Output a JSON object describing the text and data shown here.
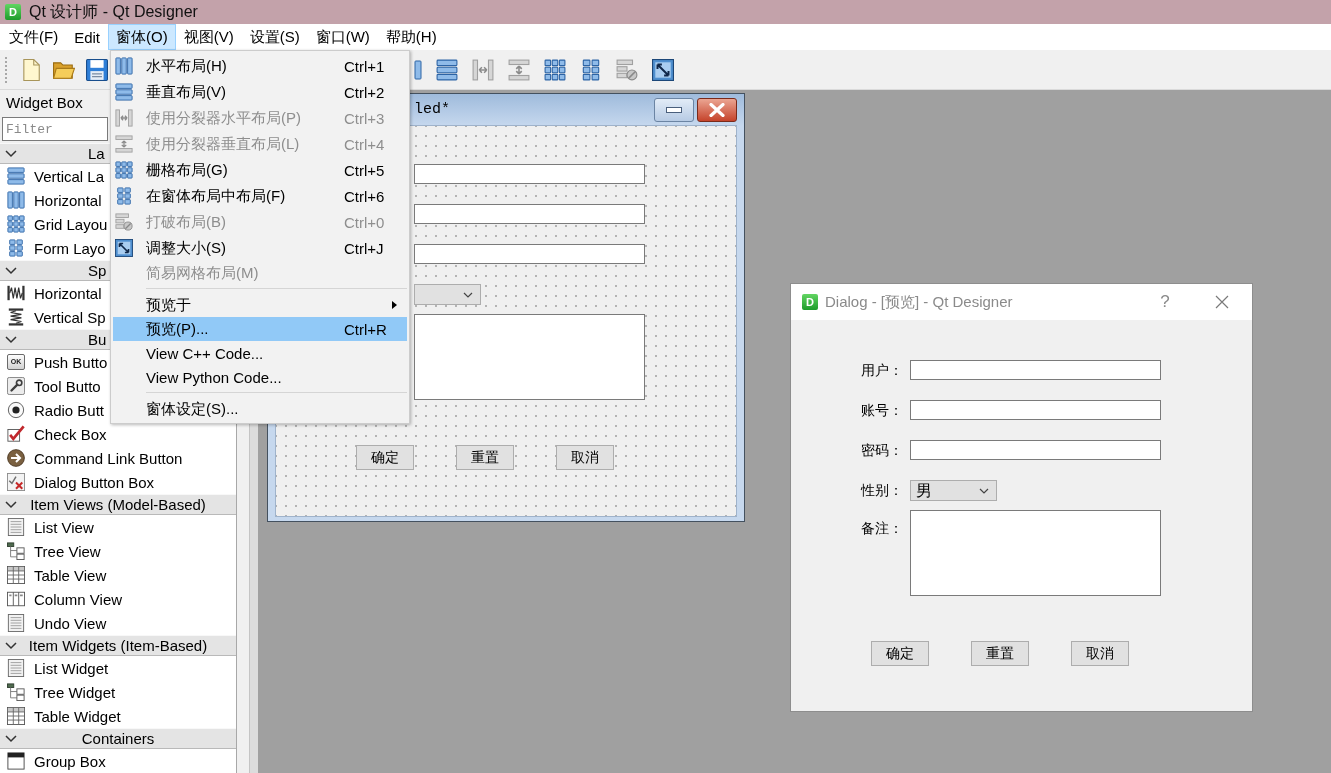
{
  "window": {
    "logo": "D",
    "title": "Qt 设计师 - Qt Designer"
  },
  "menu_bar": [
    {
      "label": "文件(F)",
      "selected": false
    },
    {
      "label": "Edit",
      "selected": false
    },
    {
      "label": "窗体(O)",
      "selected": true
    },
    {
      "label": "视图(V)",
      "selected": false
    },
    {
      "label": "设置(S)",
      "selected": false
    },
    {
      "label": "窗口(W)",
      "selected": false
    },
    {
      "label": "帮助(H)",
      "selected": false
    }
  ],
  "form_menu": {
    "sections": [
      {
        "items": [
          {
            "kind": "action",
            "label": "水平布局(H)",
            "shortcut": "Ctrl+1",
            "disabled": false,
            "selected": false
          },
          {
            "kind": "action",
            "label": "垂直布局(V)",
            "shortcut": "Ctrl+2",
            "disabled": false,
            "selected": false
          },
          {
            "kind": "action",
            "label": "使用分裂器水平布局(P)",
            "shortcut": "Ctrl+3",
            "disabled": true,
            "selected": false
          },
          {
            "kind": "action",
            "label": "使用分裂器垂直布局(L)",
            "shortcut": "Ctrl+4",
            "disabled": true,
            "selected": false
          },
          {
            "kind": "action",
            "label": "栅格布局(G)",
            "shortcut": "Ctrl+5",
            "disabled": false,
            "selected": false
          },
          {
            "kind": "action",
            "label": "在窗体布局中布局(F)",
            "shortcut": "Ctrl+6",
            "disabled": false,
            "selected": false
          },
          {
            "kind": "action",
            "label": "打破布局(B)",
            "shortcut": "Ctrl+0",
            "disabled": true,
            "selected": false
          },
          {
            "kind": "action",
            "label": "调整大小(S)",
            "shortcut": "Ctrl+J",
            "disabled": false,
            "selected": false
          },
          {
            "kind": "action",
            "label": "简易网格布局(M)",
            "disabled": true,
            "selected": false
          }
        ]
      },
      {
        "items": [
          {
            "kind": "submenu",
            "label": "预览于",
            "disabled": false,
            "selected": false
          },
          {
            "kind": "action",
            "label": "预览(P)...",
            "shortcut": "Ctrl+R",
            "disabled": false,
            "selected": true
          },
          {
            "kind": "action",
            "label": "View C++ Code...",
            "disabled": false,
            "selected": false
          },
          {
            "kind": "action",
            "label": "View Python Code...",
            "disabled": false,
            "selected": false
          }
        ]
      },
      {
        "items": [
          {
            "kind": "action",
            "label": "窗体设定(S)...",
            "disabled": false,
            "selected": false
          }
        ]
      }
    ]
  },
  "toolbar": {
    "file_tools": [
      {
        "disabled": false
      },
      {
        "disabled": false
      },
      {
        "disabled": false
      }
    ],
    "layout_tools": [
      {
        "disabled": false
      },
      {
        "disabled": false
      },
      {
        "disabled": true
      },
      {
        "disabled": true
      },
      {
        "disabled": false
      },
      {
        "disabled": false
      },
      {
        "disabled": true
      },
      {
        "disabled": false
      }
    ]
  },
  "widget_box": {
    "title": "Widget Box",
    "filter": {
      "placeholder": "Filter"
    },
    "categories": [
      {
        "label": "La",
        "expanded": true,
        "items": [
          {
            "label": "Vertical La"
          },
          {
            "label": "Horizontal"
          },
          {
            "label": "Grid Layou"
          },
          {
            "label": "Form Layo"
          }
        ]
      },
      {
        "label": "Sp",
        "expanded": true,
        "items": [
          {
            "label": "Horizontal"
          },
          {
            "label": "Vertical Sp"
          }
        ]
      },
      {
        "label": "Bu",
        "expanded": true,
        "items": [
          {
            "label": "Push Butto",
            "icon_text": "OK"
          },
          {
            "label": "Tool Butto"
          },
          {
            "label": "Radio Butt"
          },
          {
            "label": "Check Box"
          },
          {
            "label": "Command Link Button"
          },
          {
            "label": "Dialog Button Box"
          }
        ]
      },
      {
        "label": "Item Views (Model-Based)",
        "expanded": true,
        "items": [
          {
            "label": "List View"
          },
          {
            "label": "Tree View"
          },
          {
            "label": "Table View"
          },
          {
            "label": "Column View"
          },
          {
            "label": "Undo View"
          }
        ]
      },
      {
        "label": "Item Widgets (Item-Based)",
        "expanded": true,
        "items": [
          {
            "label": "List Widget"
          },
          {
            "label": "Tree Widget"
          },
          {
            "label": "Table Widget"
          }
        ]
      },
      {
        "label": "Containers",
        "expanded": true,
        "items": [
          {
            "label": "Group Box"
          }
        ]
      }
    ]
  },
  "form_window": {
    "title": "led*",
    "fields": [
      {
        "kind": "line_edit"
      },
      {
        "kind": "line_edit"
      },
      {
        "kind": "line_edit"
      },
      {
        "kind": "combo_box"
      },
      {
        "kind": "text_edit"
      }
    ],
    "buttons": [
      "确定",
      "重置",
      "取消"
    ]
  },
  "preview_dialog": {
    "logo": "D",
    "title": "Dialog - [预览] - Qt Designer",
    "help": "?",
    "fields": [
      {
        "label": "用户：",
        "kind": "line_edit"
      },
      {
        "label": "账号：",
        "kind": "line_edit"
      },
      {
        "label": "密码：",
        "kind": "line_edit"
      },
      {
        "label": "性别：",
        "kind": "combo_box",
        "value": "男"
      },
      {
        "label": "备注：",
        "kind": "text_edit"
      }
    ],
    "buttons": [
      "确定",
      "重置",
      "取消"
    ]
  }
}
